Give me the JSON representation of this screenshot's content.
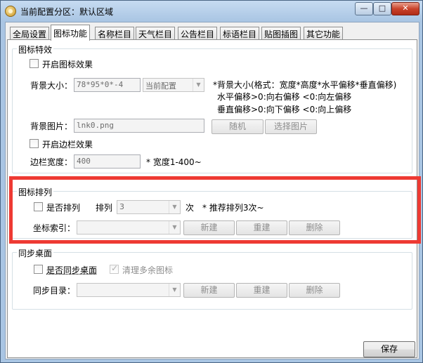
{
  "window": {
    "title": "当前配置分区：默认区域",
    "min": "—",
    "max": "□",
    "close": "✕"
  },
  "tabs": [
    "全局设置",
    "图标功能",
    "名称栏目",
    "天气栏目",
    "公告栏目",
    "标语栏目",
    "贴图插图",
    "其它功能"
  ],
  "icon_effects": {
    "title": "图标特效",
    "enable_label": "开启图标效果",
    "bg_size_label": "背景大小：",
    "bg_size_value": "78*95*0*-4",
    "bg_size_select": "当前配置",
    "hint1": "*背景大小(格式：宽度*高度*水平偏移*垂直偏移)",
    "hint2": "水平偏移>0:向右偏移 <0:向左偏移",
    "hint3": "垂直偏移>0:向下偏移 <0:向上偏移",
    "bg_image_label": "背景图片：",
    "bg_image_value": "lnk0.png",
    "random_button": "随机",
    "choose_image_button": "选择图片",
    "enable_border_label": "开启边栏效果",
    "border_width_label": "边栏宽度：",
    "border_width_value": "400",
    "border_width_hint": "* 宽度1-400~"
  },
  "icon_arrange": {
    "title": "图标排列",
    "arrange_label": "是否排列",
    "arrange_times_label": "排列",
    "arrange_times_value": "3",
    "times_unit": "次",
    "arrange_hint": "* 推荐排列3次~",
    "coord_index_label": "坐标索引：",
    "coord_index_value": "",
    "new_button": "新建",
    "rebuild_button": "重建",
    "delete_button": "删除"
  },
  "sync_desktop": {
    "title": "同步桌面",
    "sync_label": "是否同步桌面",
    "clean_label": "清理多余图标",
    "clean_check": "✓",
    "dir_label": "同步目录：",
    "dir_value": "",
    "new_button": "新建",
    "rebuild_button": "重建",
    "delete_button": "删除"
  },
  "save_button": "保存",
  "colors": {
    "highlight": "#ee3a33",
    "title_bar": "#a9c5e3"
  }
}
